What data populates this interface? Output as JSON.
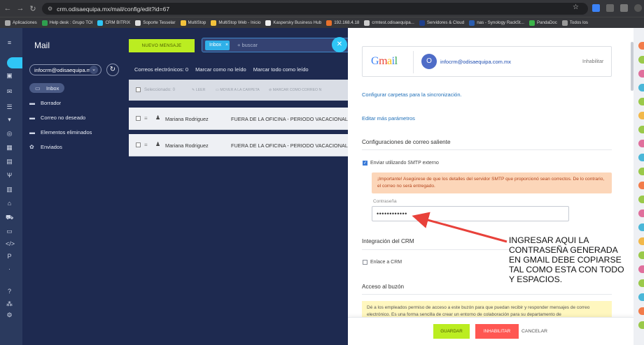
{
  "browser": {
    "url": "crm.odisaequipa.mx/mail/config/edit?id=67",
    "bookmarks": [
      "Aplicaciones",
      "Help desk : Grupo TOI",
      "CRM BITRIX",
      "Soporte Tesselar",
      "MultiStop",
      "MultiStop Web - Inicio",
      "Kaspersky Business Hub",
      "192.168.4.18",
      "crmtest.odisaequipa...",
      "Servidores & Cloud",
      "nas - Synology RackSt...",
      "PandaDoc",
      "Todos los"
    ]
  },
  "sidebar": {
    "title": "Mail",
    "account": "infocrm@odisaequipa.mx",
    "folders": [
      "Inbox",
      "Borrador",
      "Correo no deseado",
      "Elementos eliminados",
      "Enviados"
    ]
  },
  "main": {
    "new_message": "NUEVO MENSAJE",
    "search_tag": "Inbox",
    "search_placeholder": "+ buscar",
    "emails_label": "Correos electrónicos:",
    "emails_count": "0",
    "mark_unread": "Marcar como no leído",
    "mark_all_read": "Marcar todo como leído",
    "toolbar": {
      "selected": "Seleccionado: 0",
      "read": "LEER",
      "move": "MOVER A LA CARPETA",
      "mark_unread": "MARCAR COMO CORREO N"
    },
    "rows": [
      {
        "sender": "Mariana Rodriguez",
        "subject": "FUERA DE LA OFICINA - PERIODO VACACIONAL P"
      },
      {
        "sender": "Mariana Rodriguez",
        "subject": "FUERA DE LA OFICINA - PERIODO VACACIONAL P"
      }
    ]
  },
  "panel": {
    "provider_logo": "Gmail",
    "avatar_letter": "O",
    "account_email": "infocrm@odisaequipa.com.mx",
    "disable_link": "Inhabilitar",
    "config_folders_link": "Configurar carpetas para la sincronización.",
    "edit_params_link": "Editar más parámetros",
    "outgoing_section": "Configuraciones de correo saliente",
    "smtp_checkbox": "Enviar utilizando SMTP externo",
    "smtp_checked": true,
    "warning": "¡Importante! Asegúrese de que los detalles del servidor SMTP que proporcionó sean correctos. De lo contrario, el correo no será entregado.",
    "password_label": "Contraseña",
    "password_value": "••••••••••••",
    "crm_section": "Integración del CRM",
    "crm_checkbox": "Enlace a CRM",
    "crm_checked": false,
    "mailbox_section": "Acceso al buzón",
    "mailbox_info": "Dé a los empleados permiso de acceso a este buzón para que puedan recibir y responder mensajes de correo electrónico. Es una forma sencilla de crear un entorno de colaboración para su departamento de",
    "save": "GUARDAR",
    "disable_btn": "INHABILITAR",
    "cancel": "CANCELAR"
  },
  "annotation": {
    "text": "INGRESAR AQUI LA CONTRASEÑA GENERADA EN GMAIL DEBE COPIARSE TAL COMO ESTA CON TODO Y ESPACIOS.",
    "arrow_color": "#e8413a"
  },
  "colors": {
    "accent_green": "#bbed21",
    "danger_red": "#ff5752",
    "bitrix_blue": "#2fc6f6",
    "nav_bg": "#1e2a50"
  }
}
